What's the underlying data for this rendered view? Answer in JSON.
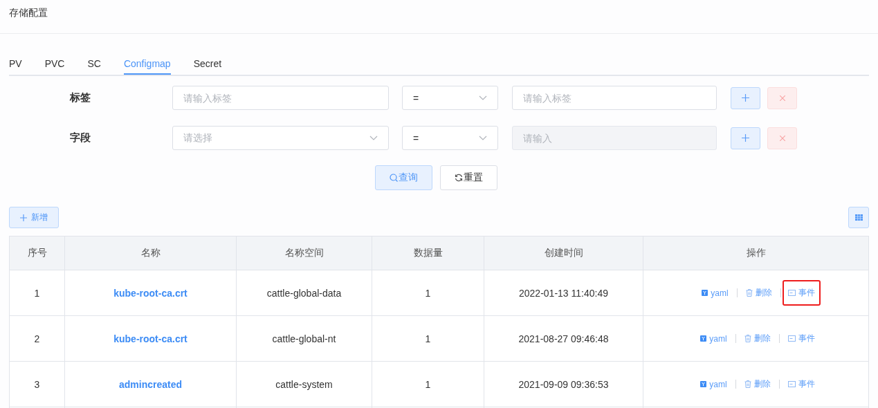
{
  "page_title": "存储配置",
  "tabs": [
    {
      "label": "PV",
      "selected": false
    },
    {
      "label": "PVC",
      "selected": false
    },
    {
      "label": "SC",
      "selected": false
    },
    {
      "label": "Configmap",
      "selected": true
    },
    {
      "label": "Secret",
      "selected": false
    }
  ],
  "filters": [
    {
      "label": "标签",
      "key_field": {
        "kind": "input",
        "placeholder": "请输入标签"
      },
      "operator": "=",
      "value_placeholder": "请输入标签",
      "value_disabled": false
    },
    {
      "label": "字段",
      "key_field": {
        "kind": "select",
        "placeholder": "请选择"
      },
      "operator": "=",
      "value_placeholder": "请输入",
      "value_disabled": true
    }
  ],
  "query_button": "查询",
  "reset_button": "重置",
  "add_button": "新增",
  "table": {
    "columns": [
      "序号",
      "名称",
      "名称空间",
      "数据量",
      "创建时间",
      "操作"
    ],
    "rows": [
      {
        "index": "1",
        "name": "kube-root-ca.crt",
        "namespace": "cattle-global-data",
        "data_count": "1",
        "created": "2022-01-13 11:40:49",
        "actions": [
          "yaml",
          "删除",
          "事件"
        ],
        "event_highlighted": true
      },
      {
        "index": "2",
        "name": "kube-root-ca.crt",
        "namespace": "cattle-global-nt",
        "data_count": "1",
        "created": "2021-08-27 09:46:48",
        "actions": [
          "yaml",
          "删除",
          "事件"
        ],
        "event_highlighted": false
      },
      {
        "index": "3",
        "name": "admincreated",
        "namespace": "cattle-system",
        "data_count": "1",
        "created": "2021-09-09 09:36:53",
        "actions": [
          "yaml",
          "删除",
          "事件"
        ],
        "event_highlighted": false
      }
    ]
  }
}
